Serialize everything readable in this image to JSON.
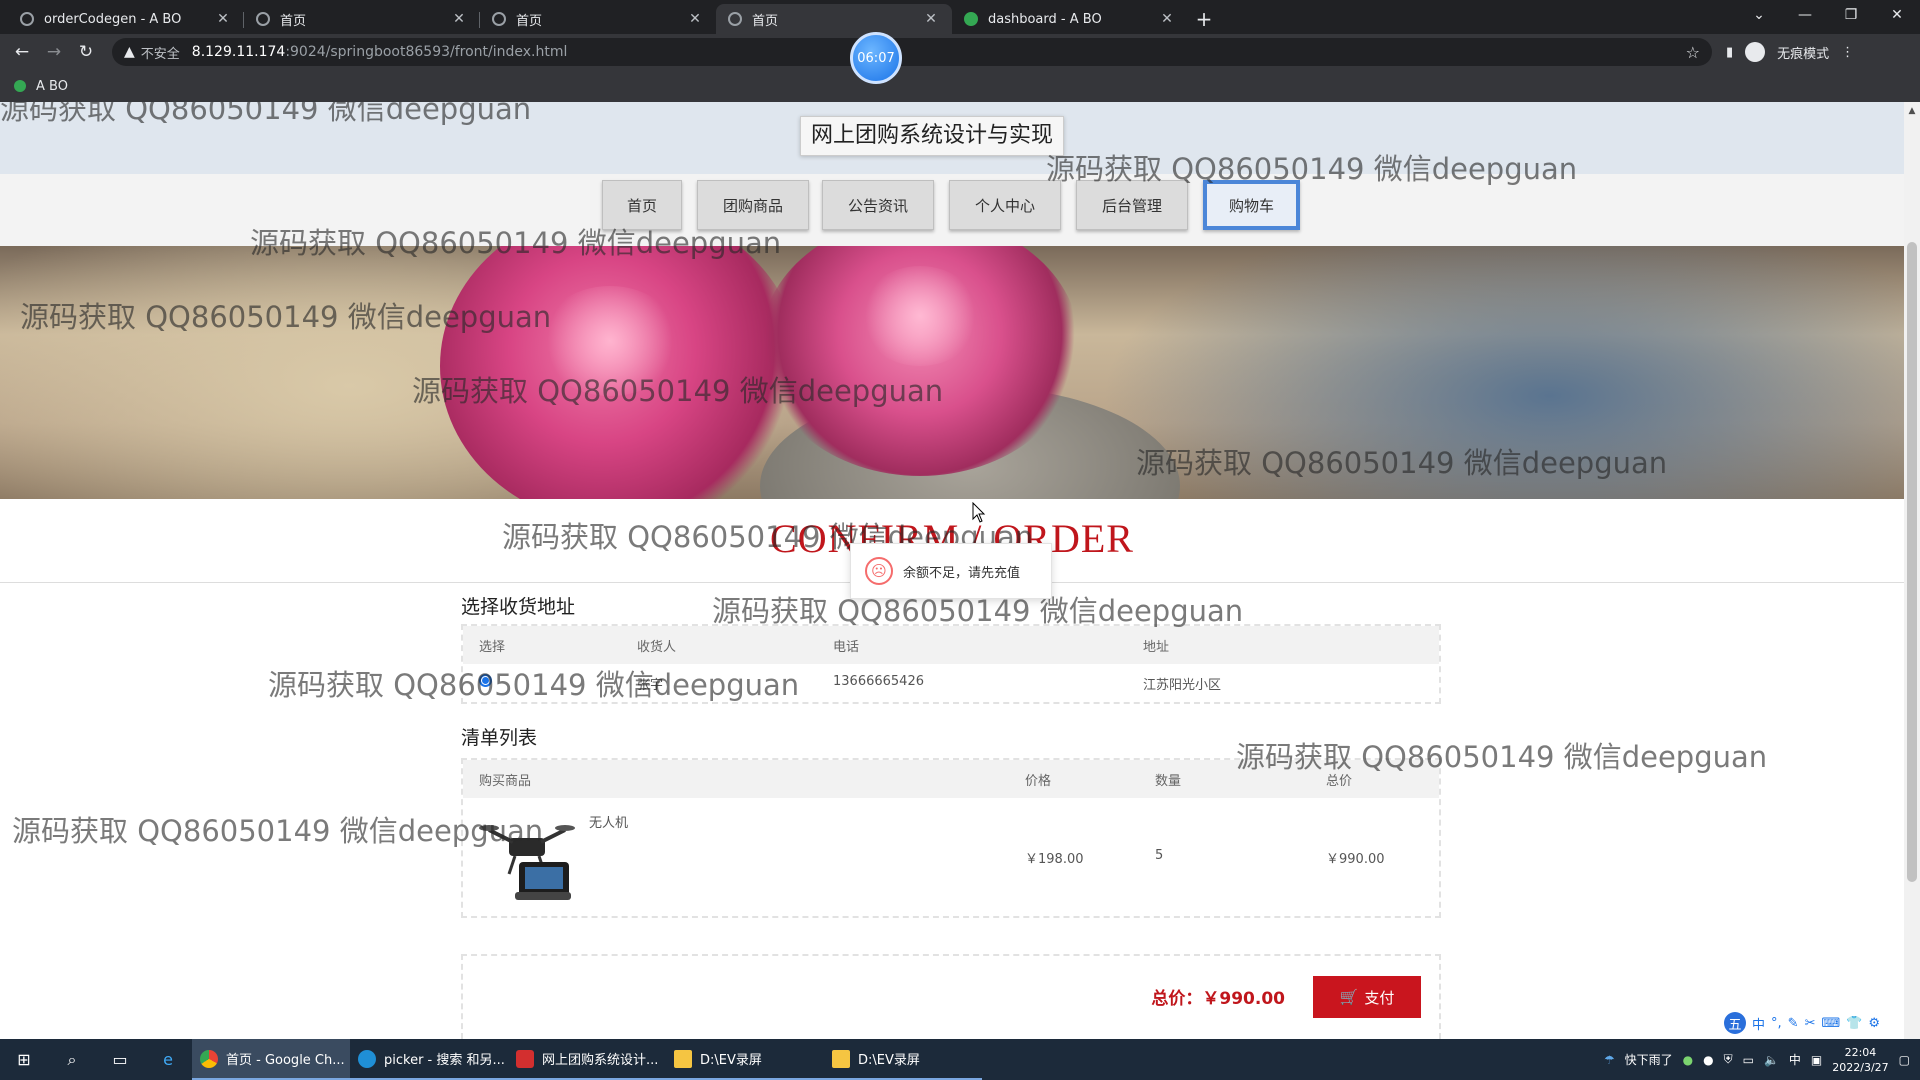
{
  "browser": {
    "tabs": [
      {
        "label": "orderCodegen - A BO",
        "icon": "globe-icon",
        "active": false
      },
      {
        "label": "首页",
        "icon": "globe-icon",
        "active": false
      },
      {
        "label": "首页",
        "icon": "globe-icon",
        "active": false
      },
      {
        "label": "首页",
        "icon": "globe-icon",
        "active": true
      },
      {
        "label": "dashboard - A BO",
        "icon": "green-dot-icon",
        "active": false
      }
    ],
    "insecure_label": "不安全",
    "url_host": "8.129.11.174",
    "url_path": ":9024/springboot86593/front/index.html",
    "incognito_label": "无痕模式",
    "bookmark_label": "A BO",
    "timer": "06:07"
  },
  "site": {
    "title": "网上团购系统设计与实现",
    "nav": [
      "首页",
      "团购商品",
      "公告资讯",
      "个人中心",
      "后台管理",
      "购物车"
    ]
  },
  "page": {
    "confirm_title": "CONFIRM / ORDER",
    "toast": "余额不足，请先充值",
    "address_title": "选择收货地址",
    "address_headers": [
      "选择",
      "收货人",
      "电话",
      "地址"
    ],
    "address_row": {
      "name": "张宇",
      "phone": "13666665426",
      "address": "江苏阳光小区"
    },
    "list_title": "清单列表",
    "list_headers": [
      "购买商品",
      "价格",
      "数量",
      "总价"
    ],
    "item": {
      "name": "无人机",
      "price": "￥198.00",
      "qty": "5",
      "total": "￥990.00"
    },
    "total_label": "总价：",
    "total_value": "￥990.00",
    "pay_label": "支付"
  },
  "watermark": "源码获取 QQ86050149 微信deepguan",
  "taskbar": {
    "apps": [
      "首页 - Google Ch...",
      "picker - 搜索 和另...",
      "网上团购系统设计...",
      "D:\\EV录屏",
      "D:\\EV录屏"
    ],
    "weather": "快下雨了",
    "ime": "中",
    "time": "22:04",
    "date": "2022/3/27"
  },
  "colors": {
    "accent": "#c0161c",
    "nav_active_border": "#4b86d8",
    "chrome_bg": "#202124"
  }
}
